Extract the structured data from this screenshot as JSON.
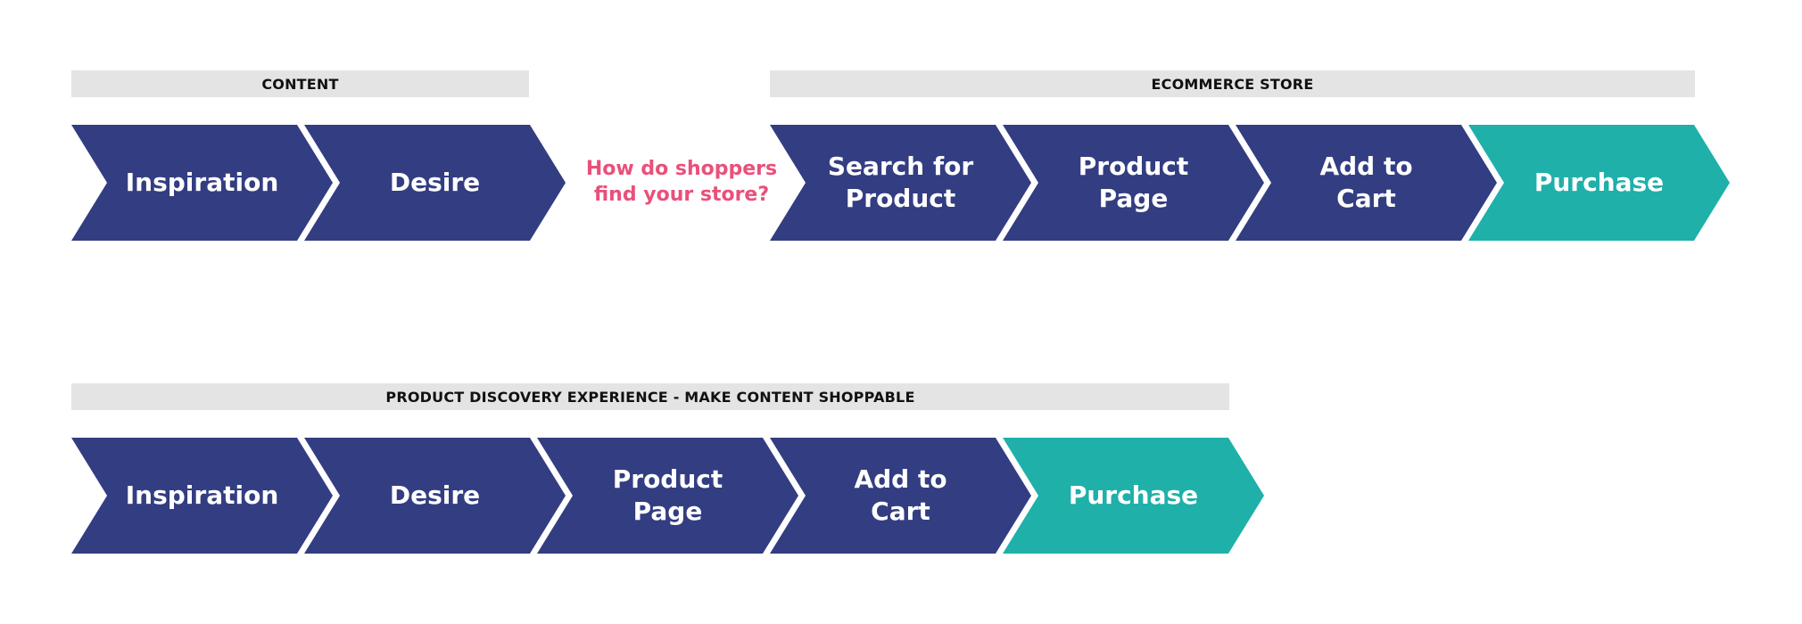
{
  "colors": {
    "step": "#333d82",
    "final_step": "#1fb0aa",
    "header_bar": "#e4e4e4",
    "question": "#e9507a"
  },
  "top_row": {
    "content_header": "CONTENT",
    "ecommerce_header": "ECOMMERCE STORE",
    "question": "How do shoppers\nfind your store?",
    "steps": [
      {
        "label": "Inspiration",
        "final": false
      },
      {
        "label": "Desire",
        "final": false
      },
      {
        "label": "Search for\nProduct",
        "final": false
      },
      {
        "label": "Product\nPage",
        "final": false
      },
      {
        "label": "Add to\nCart",
        "final": false
      },
      {
        "label": "Purchase",
        "final": true
      }
    ]
  },
  "bottom_row": {
    "header": "PRODUCT DISCOVERY EXPERIENCE - MAKE CONTENT SHOPPABLE",
    "steps": [
      {
        "label": "Inspiration",
        "final": false
      },
      {
        "label": "Desire",
        "final": false
      },
      {
        "label": "Product\nPage",
        "final": false
      },
      {
        "label": "Add to\nCart",
        "final": false
      },
      {
        "label": "Purchase",
        "final": true
      }
    ]
  }
}
